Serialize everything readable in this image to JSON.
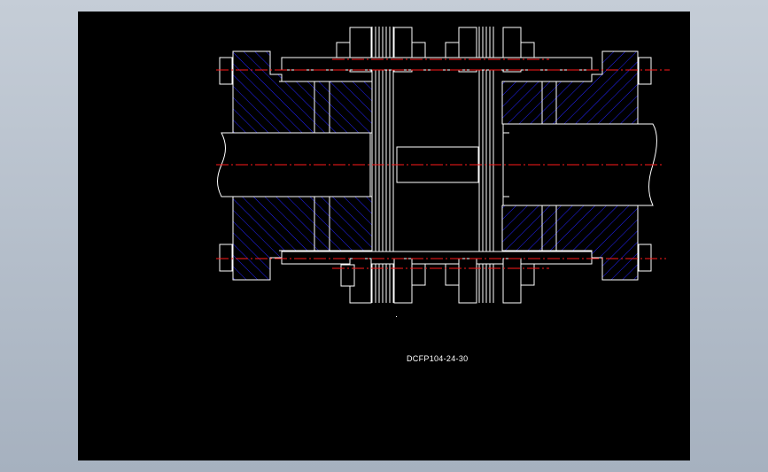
{
  "drawing": {
    "part_label": "DCFP104-24-30"
  },
  "colors": {
    "viewport_background": "#000000",
    "line": "#ffffff",
    "hatch": "#1a1aff",
    "centerline": "#ff0000",
    "app_background": "#b5bfcb"
  }
}
